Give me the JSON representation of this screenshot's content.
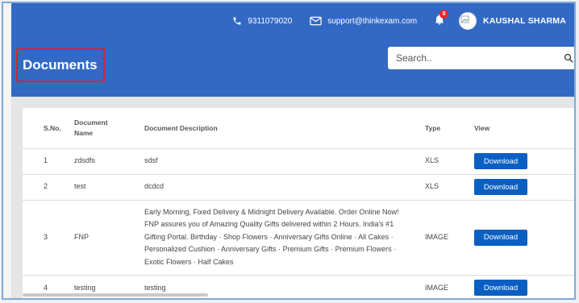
{
  "header": {
    "phone": "9311079020",
    "email": "support@thinkexam.com",
    "notification_count": "0",
    "user_name": "KAUSHAL SHARMA",
    "bg_color": "#3369c4"
  },
  "page": {
    "title": "Documents"
  },
  "search": {
    "placeholder": "Search.."
  },
  "table": {
    "headers": {
      "sno": "S.No.",
      "name": "Document Name",
      "description": "Document Description",
      "type": "Type",
      "view": "View"
    },
    "rows": [
      {
        "sno": "1",
        "name": "zdsdfs",
        "description": "sdsf",
        "type": "XLS",
        "action": "Download"
      },
      {
        "sno": "2",
        "name": "test",
        "description": "dcdcd",
        "type": "XLS",
        "action": "Download"
      },
      {
        "sno": "3",
        "name": "FNP",
        "description": "Early Morning, Fixed Delivery & Midnight Delivery Available. Order Online Now! FNP assures you of Amazing Quality Gifts delivered within 2 Hours. India's #1 Gifting Portal. Birthday · Shop Flowers · Anniversary Gifts Online · All Cakes · Personalized Cushion · Anniversary Gifts · Premium Gifts · Premium Flowers · Exotic Flowers · Half Cakes",
        "type": "IMAGE",
        "action": "Download"
      },
      {
        "sno": "4",
        "name": "testing",
        "description": "testing",
        "type": "IMAGE",
        "action": "Download"
      }
    ]
  },
  "colors": {
    "accent": "#0a5fc2",
    "highlight_border": "#e0202a"
  }
}
